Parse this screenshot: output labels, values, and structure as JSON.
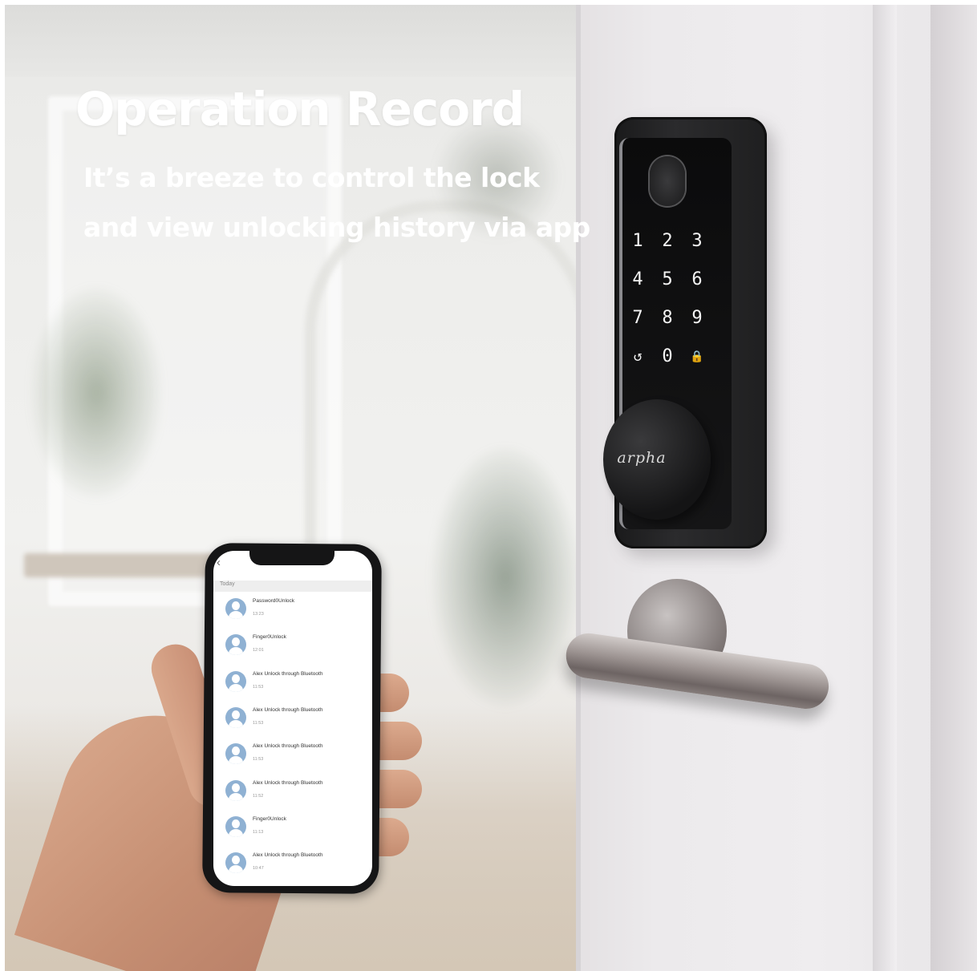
{
  "headline": {
    "title": "Operation Record",
    "subtitle_line1": "It’s a breeze to control the lock",
    "subtitle_line2": "and view unlocking history via app"
  },
  "lock": {
    "keypad": [
      "1",
      "2",
      "3",
      "4",
      "5",
      "6",
      "7",
      "8",
      "9",
      "↺",
      "0",
      "🔒"
    ],
    "brand": "arpha"
  },
  "phone": {
    "section_label": "Today",
    "records": [
      {
        "title": "Password0Unlock",
        "time": "13:23"
      },
      {
        "title": "Finger0Unlock",
        "time": "12:01"
      },
      {
        "title": "Alex Unlock through Bluetooth",
        "time": "11:53"
      },
      {
        "title": "Alex Unlock through Bluetooth",
        "time": "11:53"
      },
      {
        "title": "Alex Unlock through Bluetooth",
        "time": "11:53"
      },
      {
        "title": "Alex Unlock through Bluetooth",
        "time": "11:52"
      },
      {
        "title": "Finger0Unlock",
        "time": "11:13"
      },
      {
        "title": "Alex Unlock through Bluetooth",
        "time": "10:47"
      }
    ]
  },
  "icons": {
    "back": "chevron-left-icon",
    "avatar": "user-avatar-icon",
    "fingerprint": "fingerprint-sensor-icon"
  },
  "colors": {
    "headline_text": "#ffffff",
    "lock_body": "#1f1f20",
    "avatar": "#8fb1d3"
  }
}
